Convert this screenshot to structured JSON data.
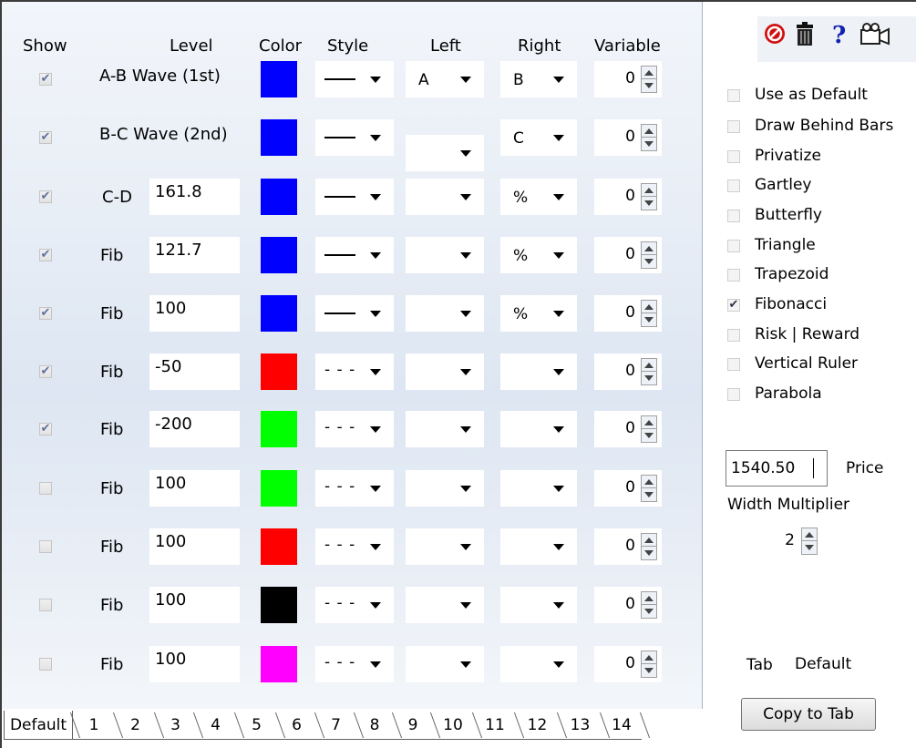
{
  "headers": {
    "show": "Show",
    "level": "Level",
    "color": "Color",
    "style": "Style",
    "left": "Left",
    "right": "Right",
    "variable": "Variable"
  },
  "rows": [
    {
      "checked": true,
      "label": "A-B Wave (1st)",
      "level": "",
      "color": "#0000ff",
      "style": "solid",
      "left": "A",
      "right": "B",
      "variable": "0"
    },
    {
      "checked": true,
      "label": "B-C Wave (2nd)",
      "level": "",
      "color": "#0000ff",
      "style": "solid",
      "left": "",
      "right": "C",
      "variable": "0"
    },
    {
      "checked": true,
      "label": "C-D",
      "level": "161.8",
      "color": "#0000ff",
      "style": "solid",
      "left": "",
      "right": "%",
      "variable": "0"
    },
    {
      "checked": true,
      "label": "Fib",
      "level": "121.7",
      "color": "#0000ff",
      "style": "solid",
      "left": "",
      "right": "%",
      "variable": "0"
    },
    {
      "checked": true,
      "label": "Fib",
      "level": "100",
      "color": "#0000ff",
      "style": "solid",
      "left": "",
      "right": "%",
      "variable": "0"
    },
    {
      "checked": true,
      "label": "Fib",
      "level": "-50",
      "color": "#ff0000",
      "style": "dashed",
      "left": "",
      "right": "",
      "variable": "0"
    },
    {
      "checked": true,
      "label": "Fib",
      "level": "-200",
      "color": "#00ff00",
      "style": "dashed",
      "left": "",
      "right": "",
      "variable": "0"
    },
    {
      "checked": false,
      "label": "Fib",
      "level": "100",
      "color": "#00ff00",
      "style": "dashed",
      "left": "",
      "right": "",
      "variable": "0"
    },
    {
      "checked": false,
      "label": "Fib",
      "level": "100",
      "color": "#ff0000",
      "style": "dashed",
      "left": "",
      "right": "",
      "variable": "0"
    },
    {
      "checked": false,
      "label": "Fib",
      "level": "100",
      "color": "#000000",
      "style": "dashed",
      "left": "",
      "right": "",
      "variable": "0"
    },
    {
      "checked": false,
      "label": "Fib",
      "level": "100",
      "color": "#ff00ff",
      "style": "dashed",
      "left": "",
      "right": "",
      "variable": "0"
    }
  ],
  "style_glyph": {
    "dashed": "- - -"
  },
  "tabs": [
    "Default",
    "1",
    "2",
    "3",
    "4",
    "5",
    "6",
    "7",
    "8",
    "9",
    "10",
    "11",
    "12",
    "13",
    "14"
  ],
  "active_tab": "Default",
  "toolbar_icons": [
    "no-entry-icon",
    "trash-icon",
    "help-icon",
    "camera-icon"
  ],
  "toolbar_glyphs": {
    "help": "?"
  },
  "options": [
    {
      "label": "Use as Default",
      "checked": false
    },
    {
      "label": "Draw Behind Bars",
      "checked": false
    },
    {
      "label": "Privatize",
      "checked": false
    },
    {
      "label": "Gartley",
      "checked": false
    },
    {
      "label": "Butterfly",
      "checked": false
    },
    {
      "label": "Triangle",
      "checked": false
    },
    {
      "label": "Trapezoid",
      "checked": false
    },
    {
      "label": "Fibonacci",
      "checked": true
    },
    {
      "label": "Risk | Reward",
      "checked": false
    },
    {
      "label": "Vertical Ruler",
      "checked": false
    },
    {
      "label": "Parabola",
      "checked": false
    }
  ],
  "price": {
    "value": "1540.50",
    "label": "Price"
  },
  "width_multiplier": {
    "label": "Width Multiplier",
    "value": "2"
  },
  "tab_name": {
    "label": "Tab",
    "value": "Default"
  },
  "copy_button": "Copy to Tab"
}
